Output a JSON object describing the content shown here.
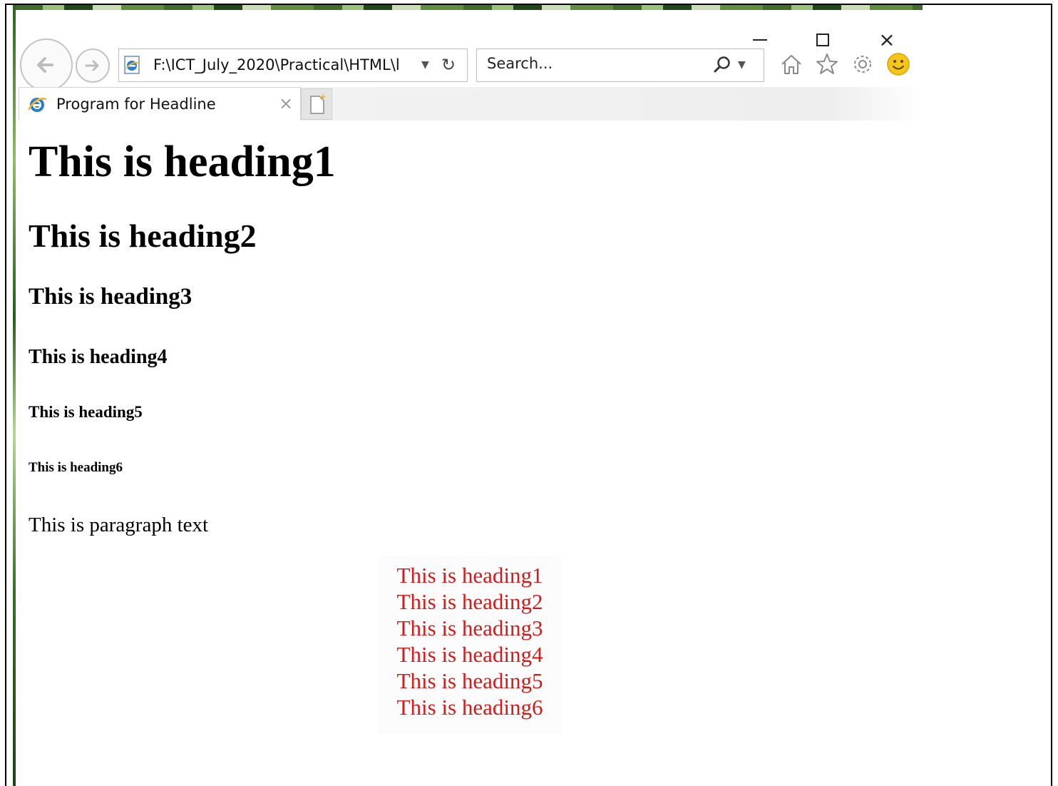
{
  "window": {
    "controls": {
      "minimize": "minimize",
      "maximize": "maximize",
      "close": "×"
    }
  },
  "toolbar": {
    "address": "F:\\ICT_July_2020\\Practical\\HTML\\l",
    "search_placeholder": "Search...",
    "icons": [
      "back-icon",
      "forward-icon",
      "ie-page-icon",
      "refresh-icon",
      "search-icon",
      "home-icon",
      "favorites-star-icon",
      "settings-gear-icon",
      "feedback-smiley-icon"
    ]
  },
  "tab": {
    "title": "Program for Headline",
    "close_label": "×"
  },
  "page": {
    "headings": [
      "This is heading1",
      "This is heading2",
      "This is heading3",
      "This is heading4",
      "This is heading5",
      "This is heading6"
    ],
    "paragraph": "This is paragraph text",
    "red_list": [
      "This is heading1",
      "This is heading2",
      "This is heading3",
      "This is heading4",
      "This is heading5",
      "This is heading6"
    ],
    "red_list_color": "#d41a1a"
  }
}
